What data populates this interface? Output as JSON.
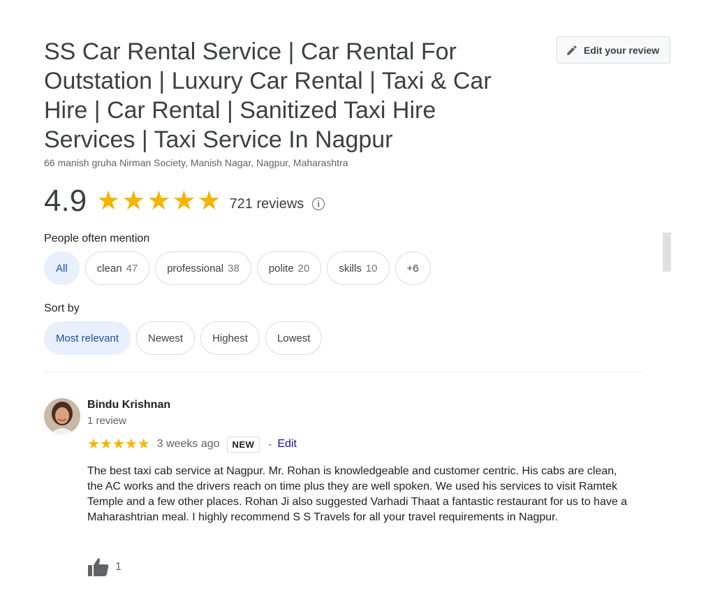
{
  "place": {
    "title": "SS Car Rental Service | Car Rental For Outstation | Luxury Car Rental | Taxi & Car Hire | Car Rental | Sanitized Taxi Hire Services | Taxi Service In Nagpur",
    "address": "66 manish gruha Nirman Society, Manish Nagar, Nagpur, Maharashtra",
    "edit_review_label": "Edit your review"
  },
  "rating": {
    "value": "4.9",
    "stars": 5,
    "review_count": "721 reviews",
    "info_icon": "info-icon"
  },
  "mentions": {
    "label": "People often mention",
    "chips": [
      {
        "label": "All",
        "count": "",
        "active": true
      },
      {
        "label": "clean",
        "count": "47",
        "active": false
      },
      {
        "label": "professional",
        "count": "38",
        "active": false
      },
      {
        "label": "polite",
        "count": "20",
        "active": false
      },
      {
        "label": "skills",
        "count": "10",
        "active": false
      },
      {
        "label": "+6",
        "count": "",
        "active": false
      }
    ]
  },
  "sort": {
    "label": "Sort by",
    "options": [
      {
        "label": "Most relevant",
        "active": true
      },
      {
        "label": "Newest",
        "active": false
      },
      {
        "label": "Highest",
        "active": false
      },
      {
        "label": "Lowest",
        "active": false
      }
    ]
  },
  "review": {
    "author": "Bindu Krishnan",
    "author_reviews": "1 review",
    "stars": 5,
    "date": "3 weeks ago",
    "badge": "NEW",
    "separator": "-",
    "edit_label": "Edit",
    "text": "The best taxi cab service at Nagpur. Mr. Rohan is knowledgeable and customer centric. His cabs are clean, the AC works and the drivers reach on time plus they are well spoken. We used his services to visit Ramtek Temple and a few other places. Rohan Ji also suggested Varhadi Thaat a fantastic restaurant for us to have a Maharashtrian meal. I highly recommend S S Travels for all your travel requirements in Nagpur.",
    "likes": "1"
  },
  "colors": {
    "star": "#f4b400",
    "active_chip_bg": "#e8f0fe",
    "active_chip_text": "#1a4fa0",
    "link": "#1a0dab"
  }
}
